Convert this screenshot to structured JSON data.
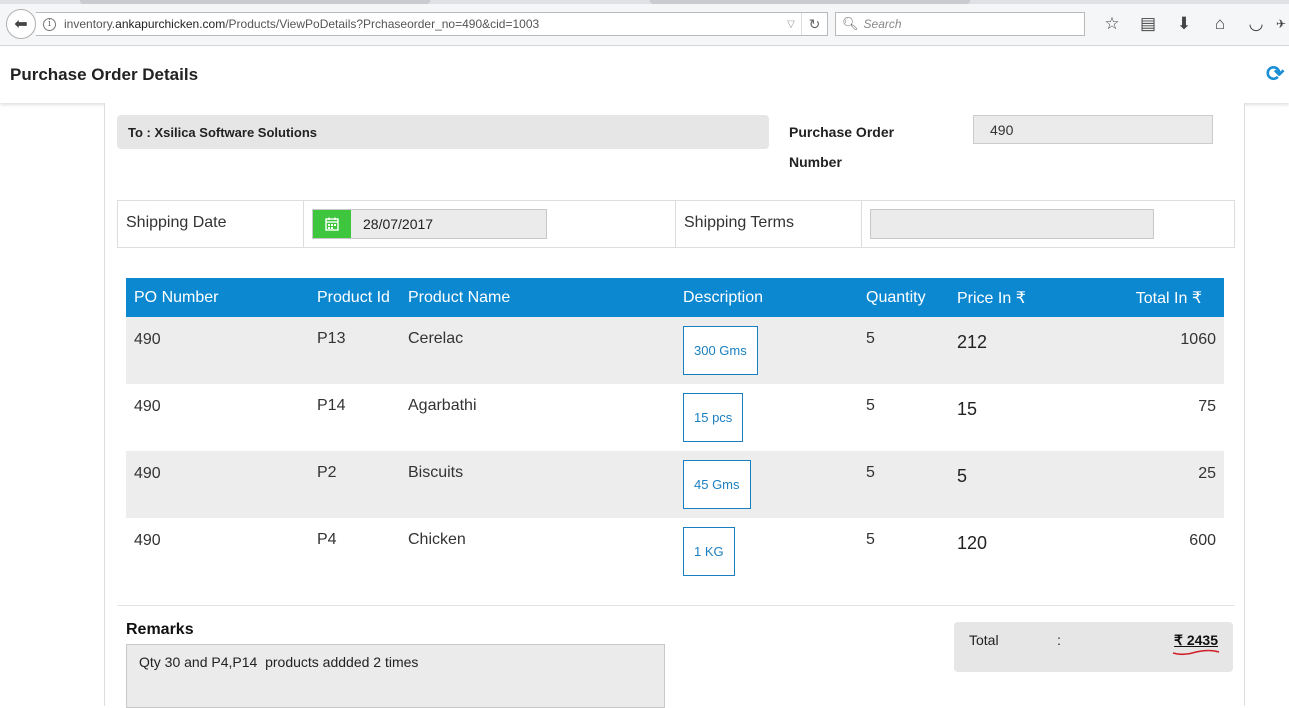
{
  "browser": {
    "url_prefix": "inventory.",
    "url_domain": "ankapurchicken.com",
    "url_path": "/Products/ViewPoDetails?Prchaseorder_no=490&cid=1003",
    "search_placeholder": "Search"
  },
  "header": {
    "title": "Purchase Order Details"
  },
  "order": {
    "to": "To : Xsilica Software Solutions",
    "po_label": "Purchase Order Number",
    "po_number": "490",
    "shipping_date_label": "Shipping Date",
    "shipping_date": "28/07/2017",
    "shipping_terms_label": "Shipping Terms",
    "shipping_terms": ""
  },
  "table": {
    "headers": [
      "PO Number",
      "Product Id",
      "Product Name",
      "Description",
      "Quantity",
      "Price In ₹",
      "Total In ₹"
    ],
    "rows": [
      {
        "po": "490",
        "pid": "P13",
        "name": "Cerelac",
        "desc": "300 Gms",
        "qty": "5",
        "price": "212",
        "total": "1060"
      },
      {
        "po": "490",
        "pid": "P14",
        "name": "Agarbathi",
        "desc": "15 pcs",
        "qty": "5",
        "price": "15",
        "total": "75"
      },
      {
        "po": "490",
        "pid": "P2",
        "name": "Biscuits",
        "desc": "45 Gms",
        "qty": "5",
        "price": "5",
        "total": "25"
      },
      {
        "po": "490",
        "pid": "P4",
        "name": "Chicken",
        "desc": "1 KG",
        "qty": "5",
        "price": "120",
        "total": "600"
      }
    ]
  },
  "remarks": {
    "label": "Remarks",
    "text": "Qty 30 and P4,P14  products addded 2 times"
  },
  "total": {
    "label": "Total",
    "colon": ":",
    "value": "₹ 2435"
  },
  "colors": {
    "header_blue": "#0c88d1",
    "calendar_green": "#3ec63e",
    "refresh_blue": "#1a8fd6"
  }
}
